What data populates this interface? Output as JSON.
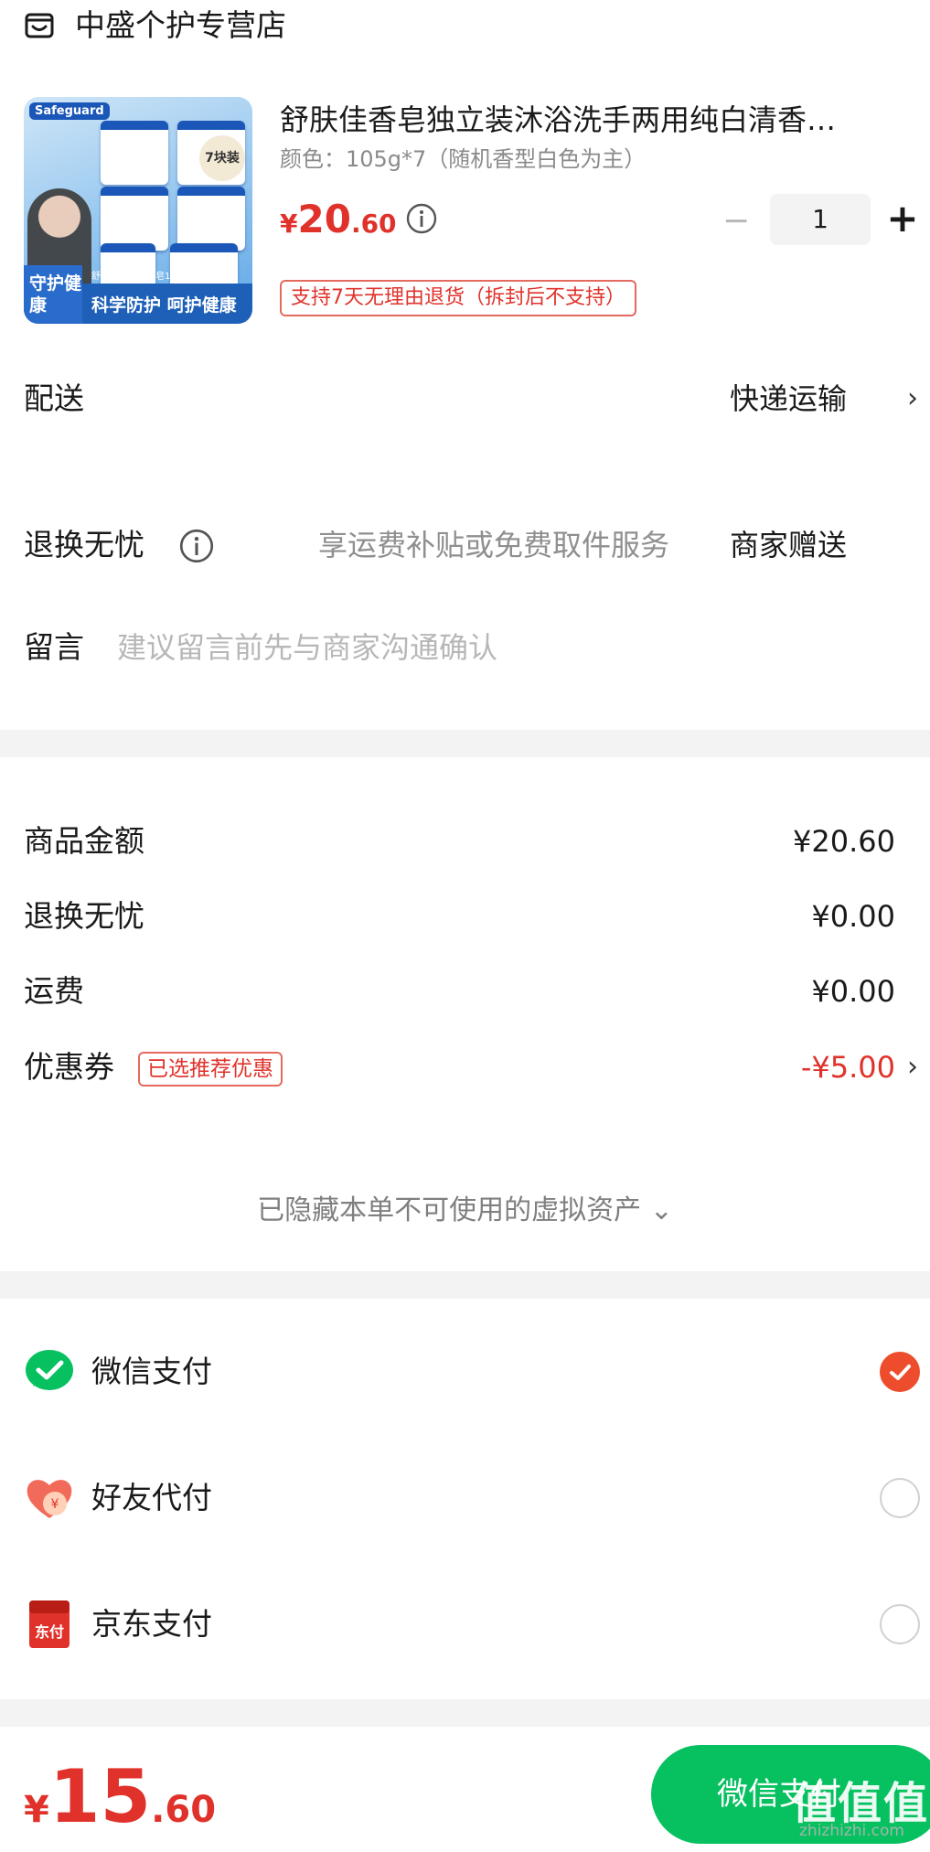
{
  "shop": {
    "name": "中盛个护专营店",
    "icon": "shop-icon"
  },
  "product": {
    "title": "舒肤佳香皂独立装沐浴洗手两用纯白清香…",
    "spec": "颜色：105g*7（随机香型白色为主）",
    "price": {
      "currency": "¥",
      "integer": "20",
      "decimal": ".60"
    },
    "quantity": "1",
    "minus_label": "−",
    "plus_label": "+",
    "return_policy": "支持7天无理由退货（拆封后不支持）",
    "image_text": {
      "brand": "Safeguard",
      "pack_badge": "7块装",
      "left_tag": "守护健康",
      "slogan": "科学防护 呵护健康",
      "subline": "舒肤佳专业健康皂105g*7块"
    }
  },
  "delivery": {
    "label": "配送",
    "value": "快递运输"
  },
  "return_service": {
    "label": "退换无忧",
    "description": "享运费补贴或免费取件服务",
    "value": "商家赠送"
  },
  "message": {
    "label": "留言",
    "placeholder": "建议留言前先与商家沟通确认"
  },
  "summary": {
    "goods_amount_label": "商品金额",
    "goods_amount": "¥20.60",
    "return_label": "退换无忧",
    "return_amount": "¥0.00",
    "shipping_label": "运费",
    "shipping_amount": "¥0.00",
    "coupon_label": "优惠券",
    "coupon_tag": "已选推荐优惠",
    "coupon_amount": "-¥5.00",
    "hidden_assets_note": "已隐藏本单不可使用的虚拟资产 ⌄"
  },
  "payment_methods": [
    {
      "label": "微信支付",
      "icon": "wechat-pay-icon",
      "selected": true
    },
    {
      "label": "好友代付",
      "icon": "friend-pay-icon",
      "selected": false
    },
    {
      "label": "京东支付",
      "icon": "jd-pay-icon",
      "selected": false,
      "icon_text": "东付"
    }
  ],
  "footer": {
    "total": {
      "currency": "¥",
      "integer": "15",
      "decimal": ".60"
    },
    "pay_button": "微信支付",
    "watermark": "值值值",
    "watermark_url": "zhizhizhi.com"
  },
  "colors": {
    "accent_red": "#e0322b",
    "wechat_green": "#07c160",
    "selected_orange": "#ed4d2c"
  }
}
